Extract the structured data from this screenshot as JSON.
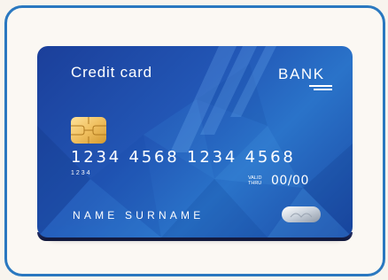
{
  "card": {
    "title": "Credit card",
    "bank_name": "BANK",
    "number": "1234  4568 1234  4568",
    "number_small": "1234",
    "valid_label_line1": "VALID",
    "valid_label_line2": "THRU",
    "expiry": "00/00",
    "holder_name": "NAME SURNAME"
  },
  "colors": {
    "frame": "#2a78c0",
    "background": "#f8f4ee",
    "card_dark": "#1b3f9a",
    "card_light": "#2a73c9",
    "chip": "#f0c060"
  }
}
